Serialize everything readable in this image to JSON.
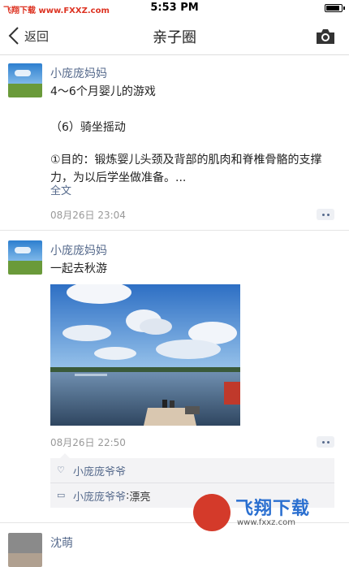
{
  "status": {
    "carrier": "飞翔下载 www.FXXZ.com",
    "time": "5:53 PM"
  },
  "nav": {
    "back_label": "返回",
    "title": "亲子圈"
  },
  "posts": [
    {
      "user": "小庞庞妈妈",
      "lines": [
        "4～6个月婴儿的游戏",
        "（6）骑坐摇动",
        "①目的：锻炼婴儿头颈及背部的肌肉和脊椎骨骼的支撑力，为以后学坐做准备。..."
      ],
      "full_text": "全文",
      "time": "08月26日 23:04"
    },
    {
      "user": "小庞庞妈妈",
      "text": "一起去秋游",
      "time": "08月26日 22:50",
      "likes": "小庞庞爷爷",
      "comments": [
        {
          "name": "小庞庞爷爷",
          "sep": ": ",
          "body": "漂亮"
        }
      ]
    },
    {
      "user": "沈萌"
    }
  ],
  "watermark": {
    "title": "飞翔下载",
    "url": "www.fxxz.com"
  }
}
